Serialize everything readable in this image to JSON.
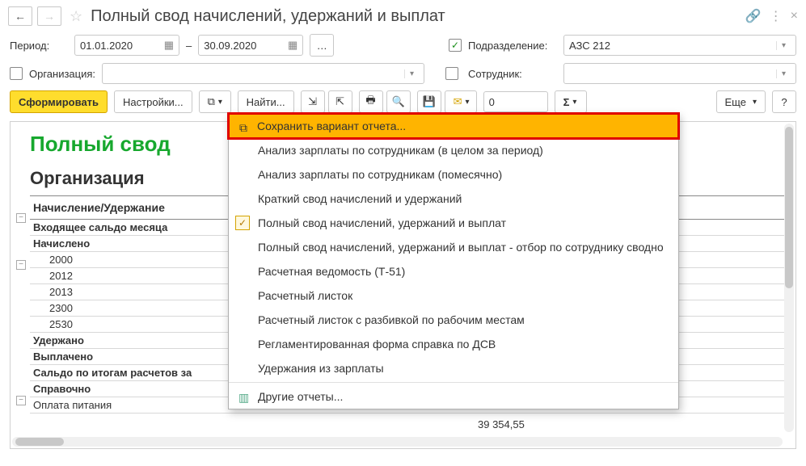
{
  "title": "Полный свод начислений, удержаний и выплат",
  "period": {
    "label": "Период:",
    "from": "01.01.2020",
    "to": "30.09.2020",
    "sep": "–"
  },
  "dept": {
    "label": "Подразделение:",
    "value": "АЗС 212"
  },
  "org": {
    "label": "Организация:",
    "value": ""
  },
  "emp": {
    "label": "Сотрудник:",
    "value": ""
  },
  "toolbar": {
    "form": "Сформировать",
    "settings": "Настройки...",
    "find": "Найти...",
    "more": "Еще",
    "sum_value": "0"
  },
  "report": {
    "title": "Полный свод",
    "subtitle": "Организация",
    "col1": "Начисление/Удержание",
    "rows": [
      {
        "text": "Входящее сальдо месяца",
        "bold": true
      },
      {
        "text": "Начислено",
        "bold": true
      },
      {
        "text": "2000",
        "indent": true
      },
      {
        "text": "2012",
        "indent": true
      },
      {
        "text": "2013",
        "indent": true
      },
      {
        "text": "2300",
        "indent": true
      },
      {
        "text": "2530",
        "indent": true
      },
      {
        "text": "Удержано",
        "bold": true
      },
      {
        "text": "Выплачено",
        "bold": true
      },
      {
        "text": "Сальдо по итогам расчетов за",
        "bold": true
      },
      {
        "text": "Справочно",
        "bold": true
      },
      {
        "text": "Оплата питания"
      }
    ],
    "footer_value": "39 354,55"
  },
  "menu": {
    "save": "Сохранить вариант отчета...",
    "items": [
      "Анализ зарплаты по сотрудникам (в целом за период)",
      "Анализ зарплаты по сотрудникам (помесячно)",
      "Краткий свод начислений и удержаний",
      "Полный свод начислений, удержаний и выплат",
      "Полный свод начислений, удержаний и выплат - отбор по сотруднику сводно",
      "Расчетная ведомость (Т-51)",
      "Расчетный листок",
      "Расчетный листок с разбивкой по рабочим местам",
      "Регламентированная форма справка по ДСВ",
      "Удержания из зарплаты"
    ],
    "checked_index": 3,
    "other": "Другие отчеты..."
  }
}
